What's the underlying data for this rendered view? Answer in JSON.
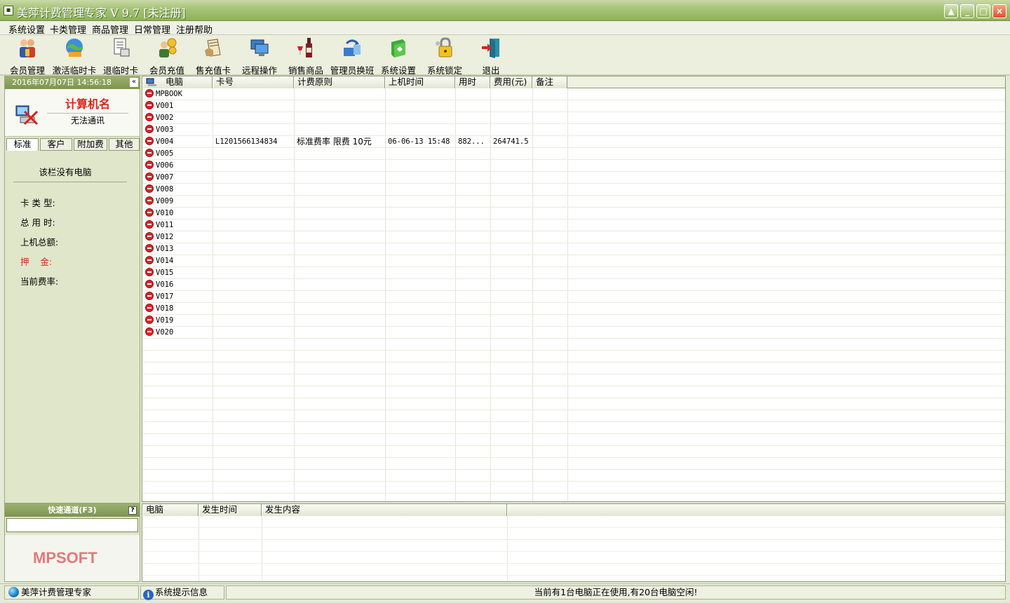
{
  "window": {
    "title": "美萍计费管理专家 V 9.7 [未注册]",
    "min_label": "_",
    "max_label": "□",
    "close_label": "×"
  },
  "menu": [
    "系统设置",
    "卡类管理",
    "商品管理",
    "日常管理",
    "注册帮助"
  ],
  "toolbar": [
    {
      "label": "会员管理",
      "icon": "member-icon"
    },
    {
      "label": "激活临时卡",
      "icon": "activate-card-icon"
    },
    {
      "label": "退临时卡",
      "icon": "return-card-icon"
    },
    {
      "label": "会员充值",
      "icon": "recharge-icon"
    },
    {
      "label": "售充值卡",
      "icon": "sell-card-icon"
    },
    {
      "label": "远程操作",
      "icon": "remote-icon"
    },
    {
      "label": "销售商品",
      "icon": "sell-goods-icon"
    },
    {
      "label": "管理员换班",
      "icon": "shift-icon"
    },
    {
      "label": "系统设置",
      "icon": "settings-icon"
    },
    {
      "label": "系统锁定",
      "icon": "lock-icon"
    },
    {
      "label": "退出",
      "icon": "exit-icon"
    }
  ],
  "left": {
    "datetime": "2016年07月07日 14:56:18",
    "collapse": "«",
    "pc_name": "计算机名",
    "pc_status": "无法通讯",
    "tabs": [
      "标准",
      "客户",
      "附加费",
      "其他"
    ],
    "active_tab": 0,
    "no_pc": "该栏没有电脑",
    "fields": {
      "card_type": "卡 类 型:",
      "total_time": "总 用 时:",
      "total_amount": "上机总额:",
      "deposit": "押    金:",
      "current_rate": "当前费率:"
    }
  },
  "grid": {
    "headers": [
      "电脑",
      "卡号",
      "计费原则",
      "上机时间",
      "用时",
      "费用(元)",
      "备注"
    ],
    "rows": [
      {
        "pc": "MPBOOK",
        "card": "",
        "rule": "",
        "start": "",
        "used": "",
        "fee": "",
        "note": ""
      },
      {
        "pc": "V001",
        "card": "",
        "rule": "",
        "start": "",
        "used": "",
        "fee": "",
        "note": ""
      },
      {
        "pc": "V002",
        "card": "",
        "rule": "",
        "start": "",
        "used": "",
        "fee": "",
        "note": ""
      },
      {
        "pc": "V003",
        "card": "",
        "rule": "",
        "start": "",
        "used": "",
        "fee": "",
        "note": ""
      },
      {
        "pc": "V004",
        "card": "L1201566134834",
        "rule": "标准费率 限费 10元",
        "start": "06-06-13 15:48",
        "used": "882...",
        "fee": "264741.5",
        "note": ""
      },
      {
        "pc": "V005",
        "card": "",
        "rule": "",
        "start": "",
        "used": "",
        "fee": "",
        "note": ""
      },
      {
        "pc": "V006",
        "card": "",
        "rule": "",
        "start": "",
        "used": "",
        "fee": "",
        "note": ""
      },
      {
        "pc": "V007",
        "card": "",
        "rule": "",
        "start": "",
        "used": "",
        "fee": "",
        "note": ""
      },
      {
        "pc": "V008",
        "card": "",
        "rule": "",
        "start": "",
        "used": "",
        "fee": "",
        "note": ""
      },
      {
        "pc": "V009",
        "card": "",
        "rule": "",
        "start": "",
        "used": "",
        "fee": "",
        "note": ""
      },
      {
        "pc": "V010",
        "card": "",
        "rule": "",
        "start": "",
        "used": "",
        "fee": "",
        "note": ""
      },
      {
        "pc": "V011",
        "card": "",
        "rule": "",
        "start": "",
        "used": "",
        "fee": "",
        "note": ""
      },
      {
        "pc": "V012",
        "card": "",
        "rule": "",
        "start": "",
        "used": "",
        "fee": "",
        "note": ""
      },
      {
        "pc": "V013",
        "card": "",
        "rule": "",
        "start": "",
        "used": "",
        "fee": "",
        "note": ""
      },
      {
        "pc": "V014",
        "card": "",
        "rule": "",
        "start": "",
        "used": "",
        "fee": "",
        "note": ""
      },
      {
        "pc": "V015",
        "card": "",
        "rule": "",
        "start": "",
        "used": "",
        "fee": "",
        "note": ""
      },
      {
        "pc": "V016",
        "card": "",
        "rule": "",
        "start": "",
        "used": "",
        "fee": "",
        "note": ""
      },
      {
        "pc": "V017",
        "card": "",
        "rule": "",
        "start": "",
        "used": "",
        "fee": "",
        "note": ""
      },
      {
        "pc": "V018",
        "card": "",
        "rule": "",
        "start": "",
        "used": "",
        "fee": "",
        "note": ""
      },
      {
        "pc": "V019",
        "card": "",
        "rule": "",
        "start": "",
        "used": "",
        "fee": "",
        "note": ""
      },
      {
        "pc": "V020",
        "card": "",
        "rule": "",
        "start": "",
        "used": "",
        "fee": "",
        "note": ""
      }
    ]
  },
  "quick": {
    "title": "快速通道(F3)",
    "help": "?",
    "input_value": "",
    "logo": "MPSOFT"
  },
  "log": {
    "headers": [
      "电脑",
      "发生时间",
      "发生内容"
    ]
  },
  "status": {
    "app": "美萍计费管理专家",
    "info": "系统提示信息",
    "message": "当前有1台电脑正在使用,有20台电脑空闲!"
  },
  "colors": {
    "accent_green": "#8fb25a",
    "alert_red": "#d9261c"
  }
}
